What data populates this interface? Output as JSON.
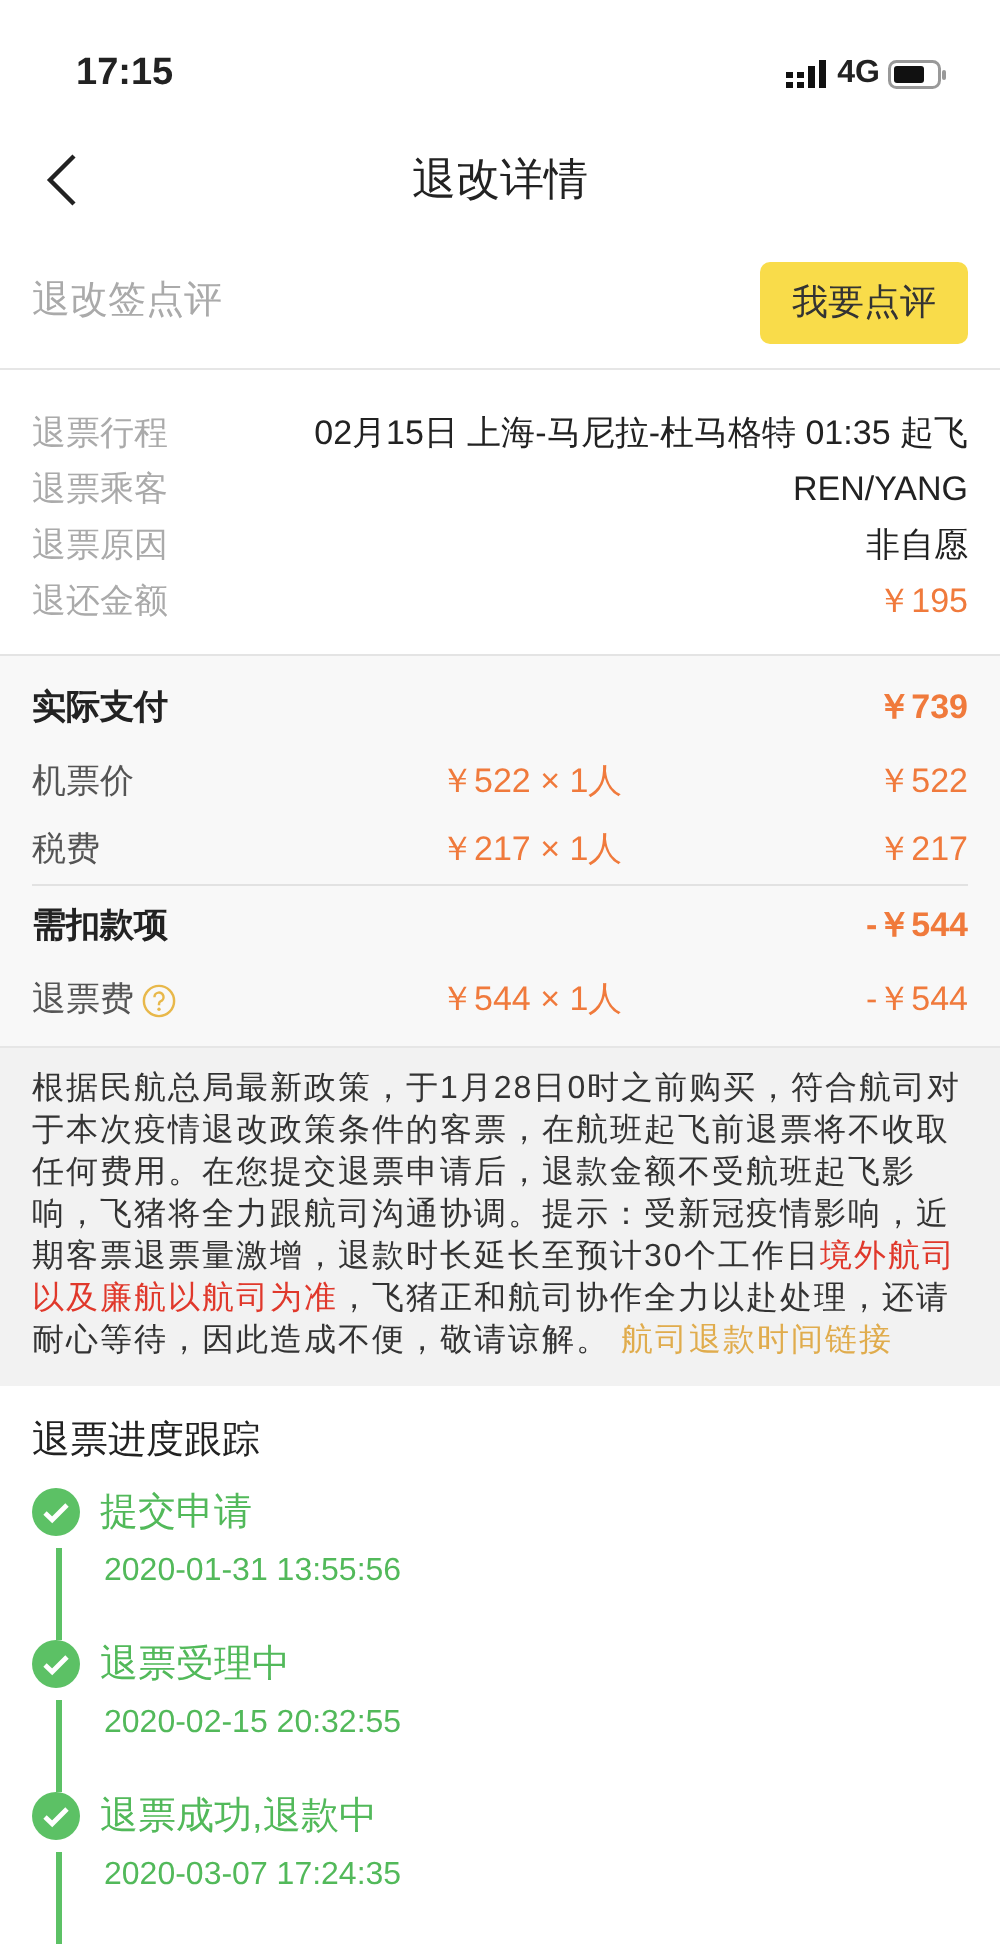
{
  "status_bar": {
    "time": "17:15",
    "network": "4G"
  },
  "nav": {
    "title": "退改详情"
  },
  "review": {
    "label": "退改签点评",
    "button": "我要点评"
  },
  "info": [
    {
      "label": "退票行程",
      "value": "02月15日 上海-马尼拉-杜马格特 01:35 起飞",
      "kind": "plain"
    },
    {
      "label": "退票乘客",
      "value": "REN/YANG",
      "kind": "plain"
    },
    {
      "label": "退票原因",
      "value": "非自愿",
      "kind": "plain"
    },
    {
      "label": "退还金额",
      "value": "￥195",
      "kind": "price"
    }
  ],
  "payment_groups": [
    {
      "title": "实际支付",
      "total": "￥739",
      "items": [
        {
          "label": "机票价",
          "unit": "￥522 × 1人",
          "amount": "￥522",
          "help": false
        },
        {
          "label": "税费",
          "unit": "￥217 × 1人",
          "amount": "￥217",
          "help": false
        }
      ]
    },
    {
      "title": "需扣款项",
      "total": "-￥544",
      "items": [
        {
          "label": "退票费",
          "unit": "￥544 × 1人",
          "amount": "-￥544",
          "help": true
        }
      ]
    }
  ],
  "notice": [
    {
      "kind": "plain",
      "text": "根据民航总局最新政策，于1月28日0时之前购买，符合航司对于本次疫情退改政策条件的客票，在航班起飞前退票将不收取任何费用。在您提交退票申请后，退款金额不受航班起飞影响，飞猪将全力跟航司沟通协调。提示：受新冠疫情影响，近期客票退票量激增，退款时长延长至预计30个工作日"
    },
    {
      "kind": "highlight",
      "text": "境外航司以及廉航以航司为准"
    },
    {
      "kind": "plain",
      "text": "，飞猪正和航司协作全力以赴处理，还请耐心等待，因此造成不便，敬请谅解。 "
    },
    {
      "kind": "link",
      "text": "航司退款时间链接"
    }
  ],
  "tracking": {
    "title": "退票进度跟踪",
    "steps": [
      {
        "name": "提交申请",
        "time": "2020-01-31 13:55:56",
        "done": true
      },
      {
        "name": "退票受理中",
        "time": "2020-02-15 20:32:55",
        "done": true
      },
      {
        "name": "退票成功,退款中",
        "time": "2020-03-07 17:24:35",
        "done": true
      }
    ]
  }
}
